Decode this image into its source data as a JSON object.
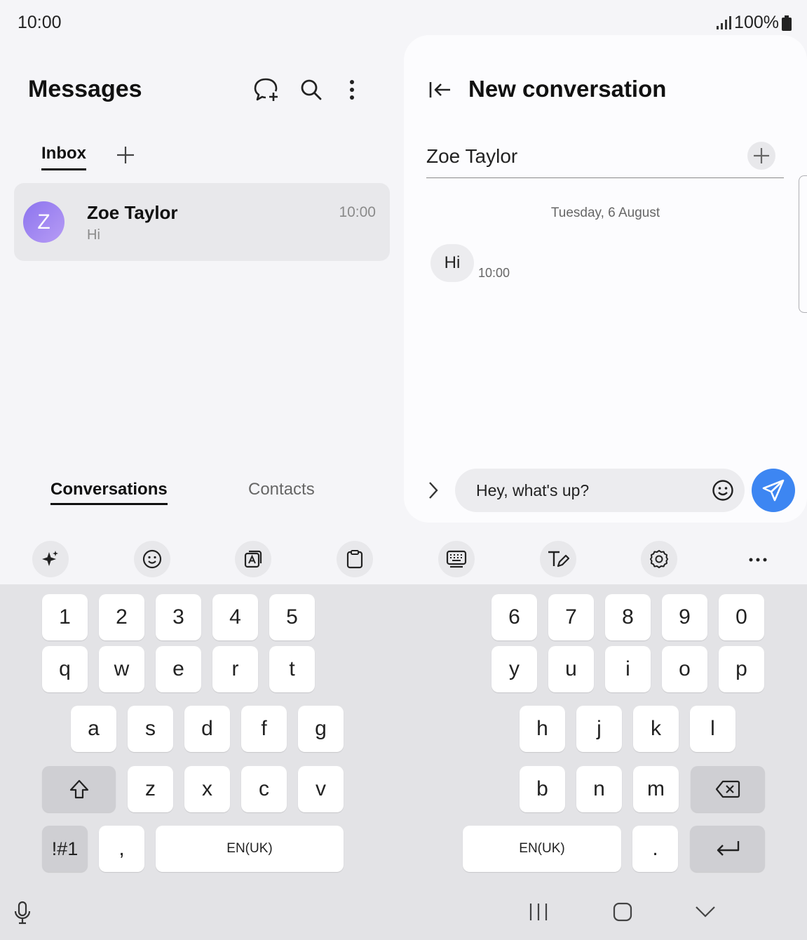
{
  "status_bar": {
    "time": "10:00",
    "battery": "100%"
  },
  "left_pane": {
    "title": "Messages",
    "tab_inbox": "Inbox",
    "conversation": {
      "avatar_letter": "Z",
      "name": "Zoe Taylor",
      "preview": "Hi",
      "time": "10:00"
    },
    "bottom_tabs": {
      "active": "Conversations",
      "inactive": "Contacts"
    }
  },
  "right_pane": {
    "title": "New conversation",
    "recipient": "Zoe Taylor",
    "date_separator": "Tuesday, 6 August",
    "message": {
      "text": "Hi",
      "time": "10:00"
    },
    "compose_text": "Hey, what's up?"
  },
  "keyboard": {
    "row_numbers_left": [
      "1",
      "2",
      "3",
      "4",
      "5"
    ],
    "row_numbers_right": [
      "6",
      "7",
      "8",
      "9",
      "0"
    ],
    "row1_left": [
      "q",
      "w",
      "e",
      "r",
      "t"
    ],
    "row1_right": [
      "y",
      "u",
      "i",
      "o",
      "p"
    ],
    "row2_left": [
      "a",
      "s",
      "d",
      "f",
      "g"
    ],
    "row2_right": [
      "h",
      "j",
      "k",
      "l"
    ],
    "row3_left": [
      "z",
      "x",
      "c",
      "v"
    ],
    "row3_right": [
      "b",
      "n",
      "m"
    ],
    "symbols_key": "!#1",
    "comma_key": ",",
    "space_label_left": "EN(UK)",
    "space_label_right": "EN(UK)",
    "period_key": "."
  },
  "icons": {
    "toolbar": [
      "ai-sparkle-icon",
      "emoji-icon",
      "sticker-icon",
      "clipboard-icon",
      "keyboard-mode-icon",
      "handwriting-icon",
      "settings-icon",
      "more-icon"
    ],
    "nav": [
      "recent-apps-icon",
      "home-icon",
      "hide-keyboard-icon"
    ]
  },
  "colors": {
    "send_button": "#3d86f2",
    "avatar": "#8c74ee"
  }
}
